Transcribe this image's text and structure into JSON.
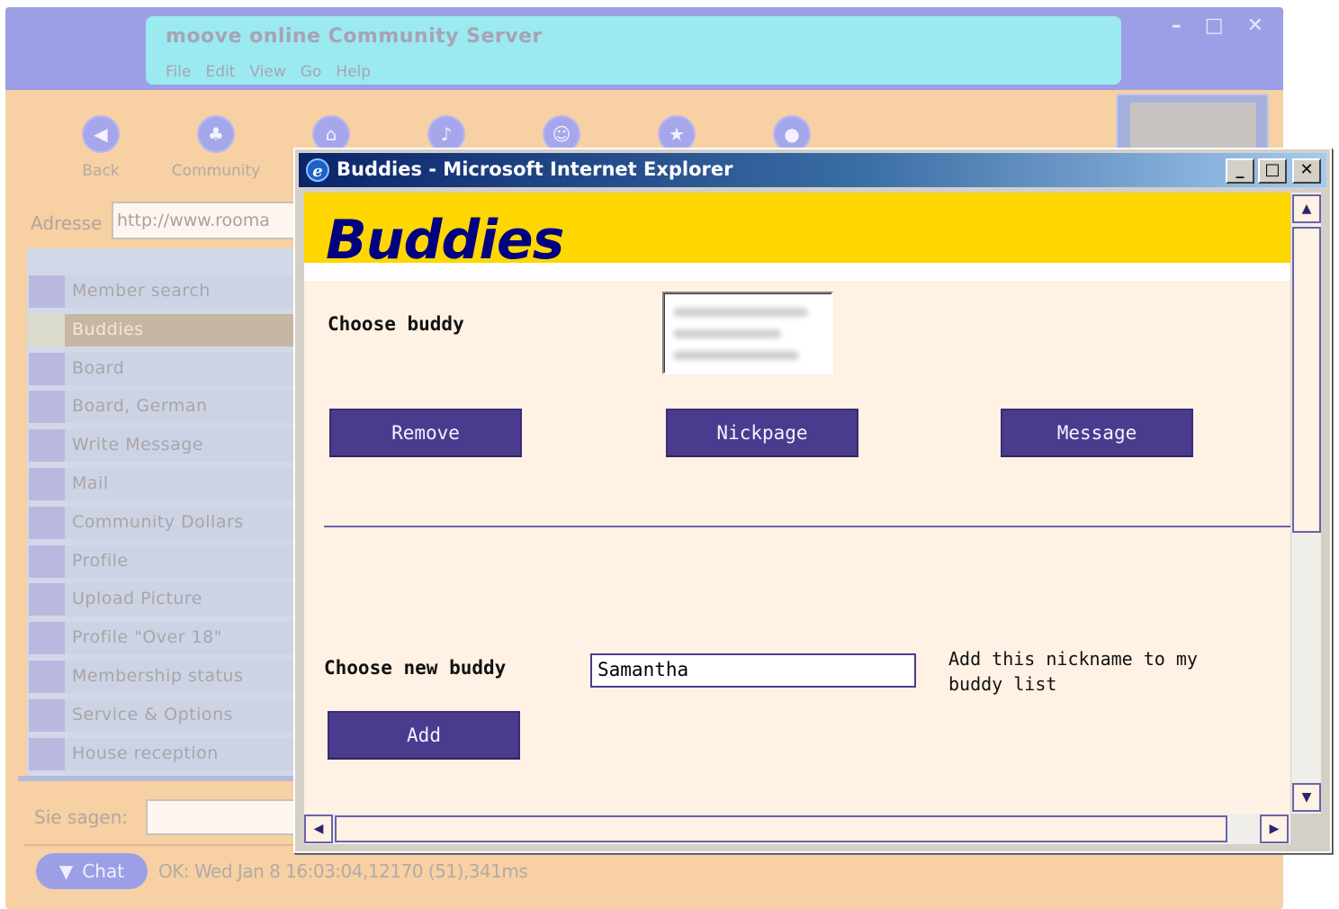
{
  "background_app": {
    "title": "moove online Community Server",
    "menu": [
      "File",
      "Edit",
      "View",
      "Go",
      "Help"
    ],
    "window_controls": {
      "minimize": "–",
      "maximize": "□",
      "close": "✕"
    },
    "toolbar": [
      {
        "label": "Back",
        "icon": "◀"
      },
      {
        "label": "Community",
        "icon": "♣"
      },
      {
        "label": "",
        "icon": "⌂"
      },
      {
        "label": "",
        "icon": "♪"
      },
      {
        "label": "",
        "icon": "☺"
      },
      {
        "label": "",
        "icon": "★"
      },
      {
        "label": "",
        "icon": "●"
      }
    ],
    "address_label": "Adresse",
    "address_value": "http://www.rooma",
    "sidebar_items": [
      "Member search",
      "Buddies",
      "Board",
      "Board, German",
      "Write Message",
      "Mail",
      "Community Dollars",
      "Profile",
      "Upload Picture",
      "Profile \"Over 18\"",
      "Membership status",
      "Service & Options",
      "House reception"
    ],
    "active_sidebar_item": "Buddies",
    "say_label": "Sie sagen:",
    "chat_button": "Chat",
    "status_text": "OK: Wed Jan 8 16:03:04,12170 (51),341ms"
  },
  "ie_window": {
    "title": "Buddies - Microsoft Internet Explorer",
    "icon_glyph": "e",
    "controls": {
      "minimize": "_",
      "maximize": "□",
      "close": "✕"
    },
    "banner_title": "Buddies",
    "choose_buddy_label": "Choose buddy",
    "buttons": {
      "remove": "Remove",
      "nickpage": "Nickpage",
      "message": "Message",
      "add": "Add"
    },
    "choose_new_label": "Choose new buddy",
    "new_buddy_value": "Samantha",
    "add_hint": "Add this nickname to my buddy list",
    "scroll_glyphs": {
      "up": "▲",
      "down": "▼",
      "left": "◀",
      "right": "▶"
    }
  },
  "colors": {
    "banner": "#ffd700",
    "banner_text": "#000080",
    "button": "#4b3b8f",
    "content_bg": "#fff1e3",
    "app_bg": "#f7d0a3"
  }
}
